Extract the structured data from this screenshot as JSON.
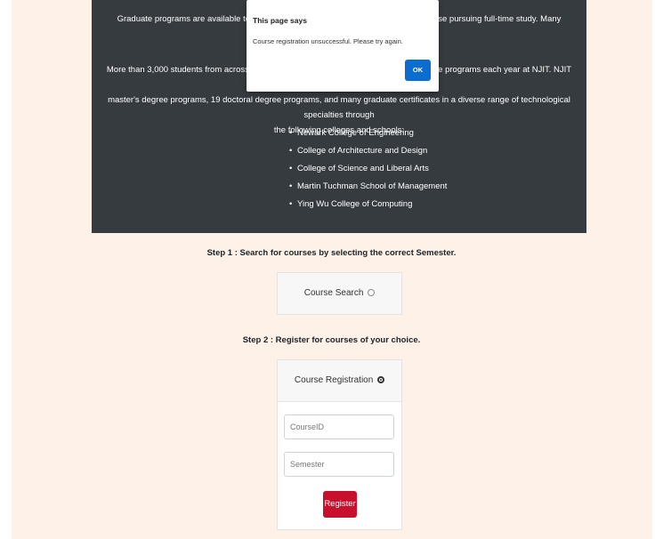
{
  "hero": {
    "para1": "Graduate programs are available to full-time, part-time, and online students and to those pursuing full-time study. Many programs are also offered",
    "para2_line1": "More than 3,000 students from across the country and around the world enroll in graduate programs each year at NJIT. NJIT currently offers about 50",
    "para2_line2": "master's degree programs, 19 doctoral degree programs, and many graduate certificates in a diverse range of technological specialties through",
    "para2_line3": "the following colleges and schools:",
    "colleges": [
      "Newark College of Engineering",
      "College of Architecture and Design",
      "College of Science and Liberal Arts",
      "Martin Tuchman School of Management",
      "Ying Wu College of Computing"
    ]
  },
  "step1": "Step 1 : Search for courses by selecting the correct Semester.",
  "search_card": {
    "title": "Course Search",
    "selected": false
  },
  "step2": "Step 2 : Register for courses of your choice.",
  "registration_card": {
    "title": "Course Registration",
    "selected": true,
    "course_placeholder": "CourseID",
    "semester_placeholder": "Semester",
    "register_label": "Register",
    "register_color": "#c8102e"
  },
  "dialog": {
    "title": "This page says",
    "message": "Course registration unsuccessful. Please try again.",
    "ok_label": "OK",
    "ok_color": "#0a6ed1"
  }
}
